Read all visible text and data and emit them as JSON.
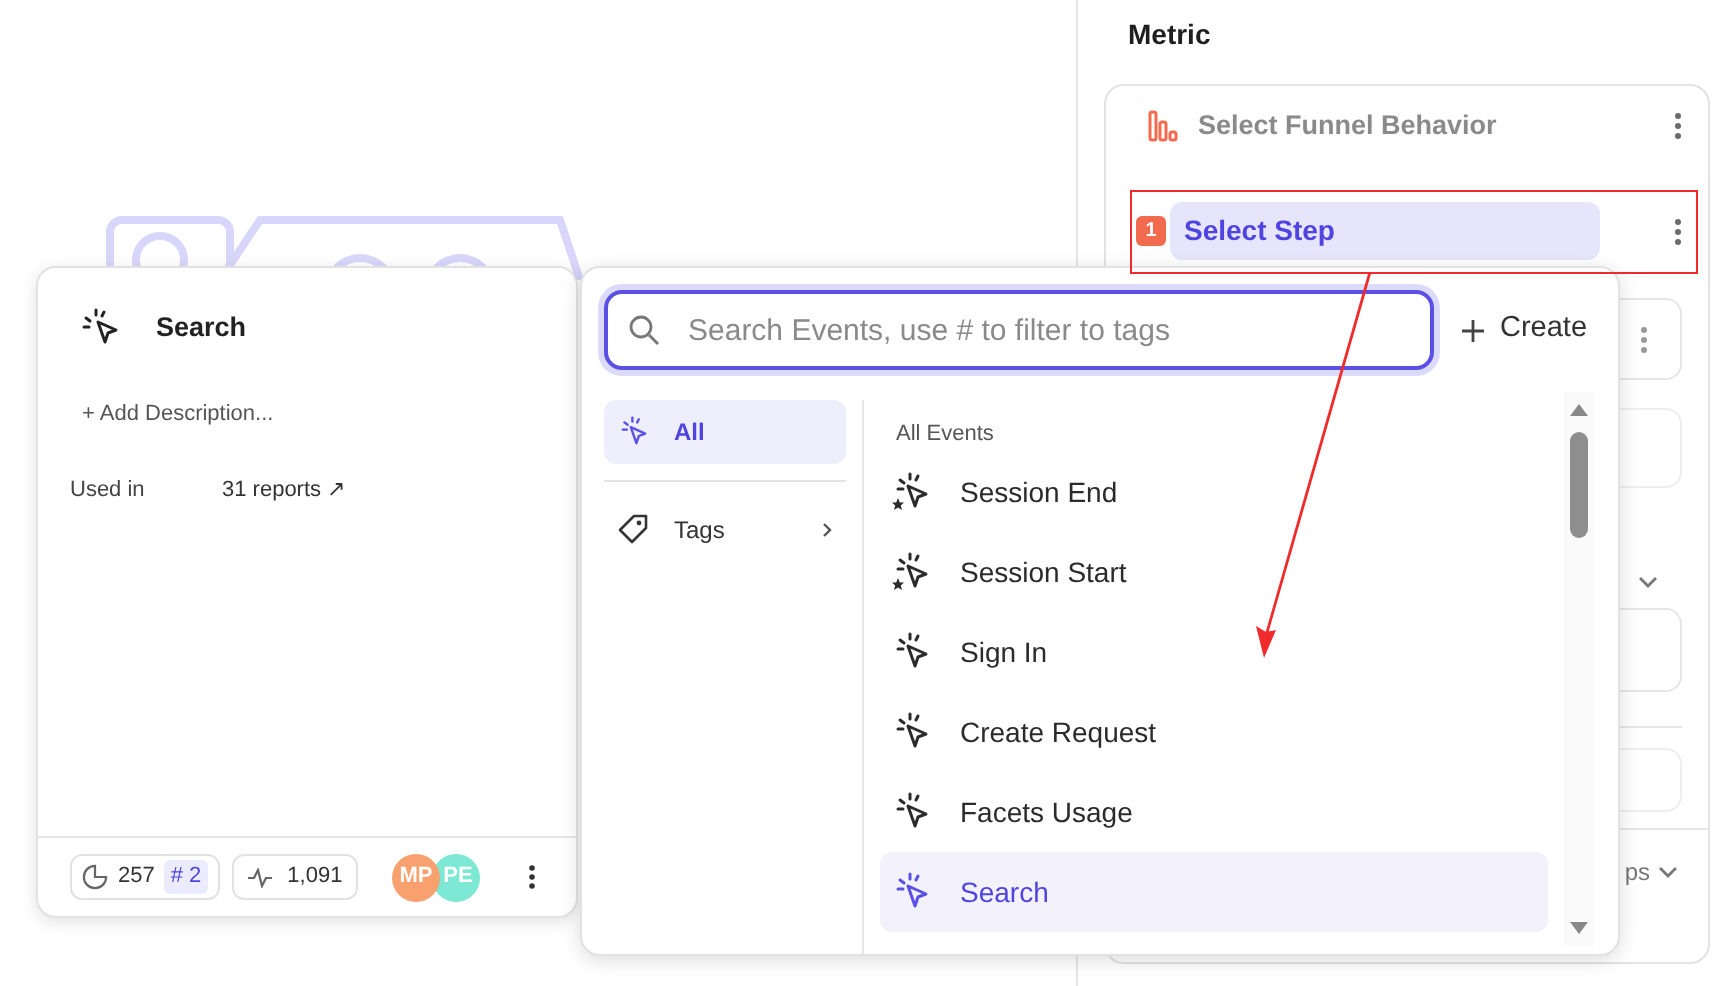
{
  "metric_panel": {
    "title": "Metric",
    "behavior": "Select Funnel Behavior",
    "step": {
      "number": "1",
      "label": "Select Step"
    },
    "partial_label": "ps"
  },
  "event_card": {
    "title": "Search",
    "add_description": "+ Add Description...",
    "used_in_label": "Used in",
    "used_in_value": "31 reports ↗",
    "queries": "257",
    "rank": "# 2",
    "volume": "1,091",
    "avatars": [
      {
        "initials": "MP",
        "color": "#f9a06f"
      },
      {
        "initials": "PE",
        "color": "#7de8d3"
      }
    ]
  },
  "event_picker": {
    "search": {
      "placeholder": "Search Events, use # to filter to tags"
    },
    "create_label": "Create",
    "categories": [
      {
        "label": "All",
        "selected": true,
        "kind": "all"
      },
      {
        "label": "Tags",
        "selected": false,
        "kind": "tags"
      }
    ],
    "heading": "All Events",
    "events": [
      {
        "label": "Session End",
        "kind": "auto",
        "selected": false
      },
      {
        "label": "Session Start",
        "kind": "auto",
        "selected": false
      },
      {
        "label": "Sign In",
        "kind": "custom",
        "selected": false
      },
      {
        "label": "Create Request",
        "kind": "custom",
        "selected": false
      },
      {
        "label": "Facets Usage",
        "kind": "custom",
        "selected": false
      },
      {
        "label": "Search",
        "kind": "custom",
        "selected": true
      }
    ]
  }
}
